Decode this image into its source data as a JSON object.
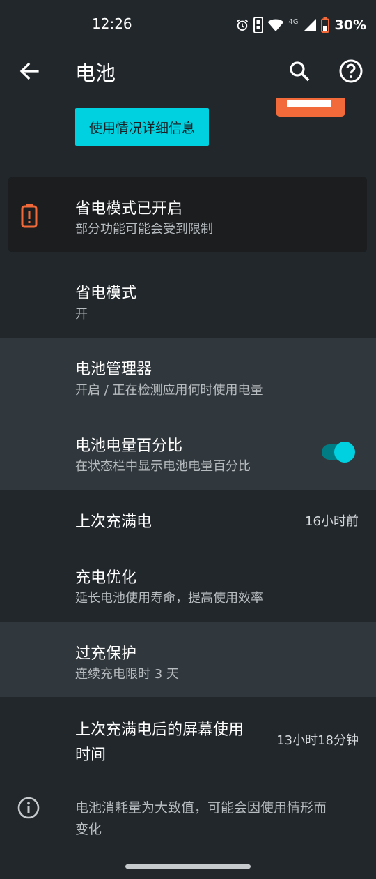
{
  "status_bar": {
    "time": "12:26",
    "network": "4G",
    "battery_percent": "30%"
  },
  "app_bar": {
    "title": "电池",
    "back_icon": "arrow-back-icon",
    "search_icon": "search-icon",
    "help_icon": "help-icon"
  },
  "usage": {
    "detail_button": "使用情况详细信息"
  },
  "saver_card": {
    "title": "省电模式已开启",
    "subtitle": "部分功能可能会受到限制",
    "icon": "battery-alert-icon",
    "accent": "#f26a3a"
  },
  "rows": {
    "power_saver": {
      "title": "省电模式",
      "subtitle": "开"
    },
    "battery_manager": {
      "title": "电池管理器",
      "subtitle": "开启 / 正在检测应用何时使用电量"
    },
    "battery_percentage": {
      "title": "电池电量百分比",
      "subtitle": "在状态栏中显示电池电量百分比",
      "enabled": true
    },
    "last_full_charge": {
      "title": "上次充满电",
      "value": "16小时前"
    },
    "charge_optimization": {
      "title": "充电优化",
      "subtitle": "延长电池使用寿命，提高使用效率"
    },
    "overcharge_protection": {
      "title": "过充保护",
      "subtitle": "连续充电限时 3 天"
    },
    "screen_usage": {
      "title_line1": "上次充满电后的屏幕使用",
      "title_line2": "时间",
      "value": "13小时18分钟"
    }
  },
  "footer": {
    "note_line1": "电池消耗量为大致值，可能会因使用情形而",
    "note_line2": "变化",
    "icon": "info-icon"
  },
  "colors": {
    "background": "#21272b",
    "accent": "#00d1e0",
    "highlight": "#31383d"
  }
}
